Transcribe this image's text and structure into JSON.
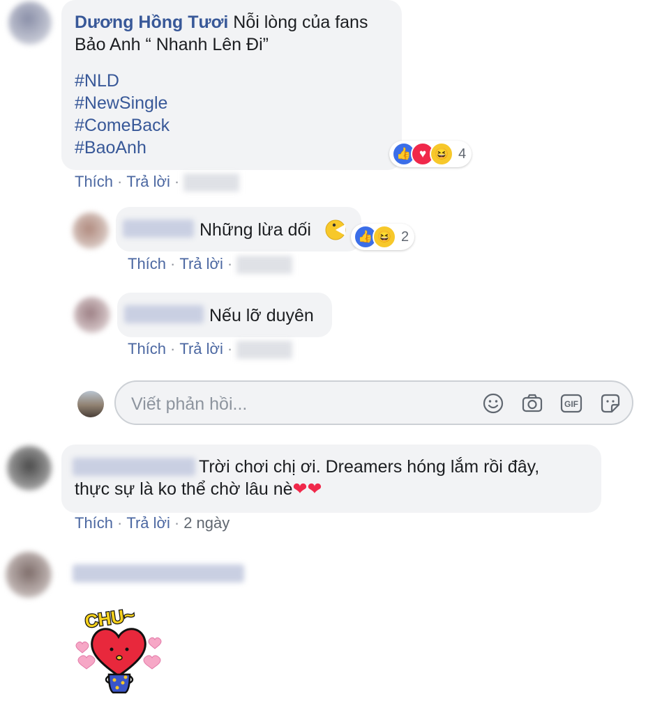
{
  "comment1": {
    "author": "Dương Hồng Tươi",
    "text_line1": " Nỗi lòng của fans",
    "text_line2": "Bảo Anh “ Nhanh Lên Đi”",
    "hashtags": [
      "#NLD",
      "#NewSingle",
      "#ComeBack",
      "#BaoAnh"
    ],
    "reaction_count": "4",
    "actions": {
      "like": "Thích",
      "reply": "Trả lời",
      "separator": "·"
    }
  },
  "reply1": {
    "text": "Những lừa dối",
    "reaction_count": "2",
    "actions": {
      "like": "Thích",
      "reply": "Trả lời",
      "separator": "·"
    }
  },
  "reply2": {
    "text": "Nếu lỡ duyên",
    "actions": {
      "like": "Thích",
      "reply": "Trả lời",
      "separator": "·"
    }
  },
  "reply_box": {
    "placeholder": "Viết phản hồi...",
    "tools": [
      "emoji-icon",
      "camera-icon",
      "gif-icon",
      "sticker-icon"
    ]
  },
  "comment2": {
    "text_line1": "Trời chơi chị ơi. Dreamers hóng lắm rồi đây,",
    "text_line2": "thực sự là ko thể chờ lâu nè",
    "emoji": "❤❤",
    "actions": {
      "like": "Thích",
      "reply": "Trả lời",
      "separator": "·",
      "time": "2 ngày"
    }
  },
  "comment3": {
    "sticker_text": "CHU~"
  },
  "colors": {
    "link": "#385898",
    "bubble": "#f2f3f5",
    "like": "#3b6ee8",
    "love": "#f0284a",
    "haha": "#f7c82a"
  }
}
